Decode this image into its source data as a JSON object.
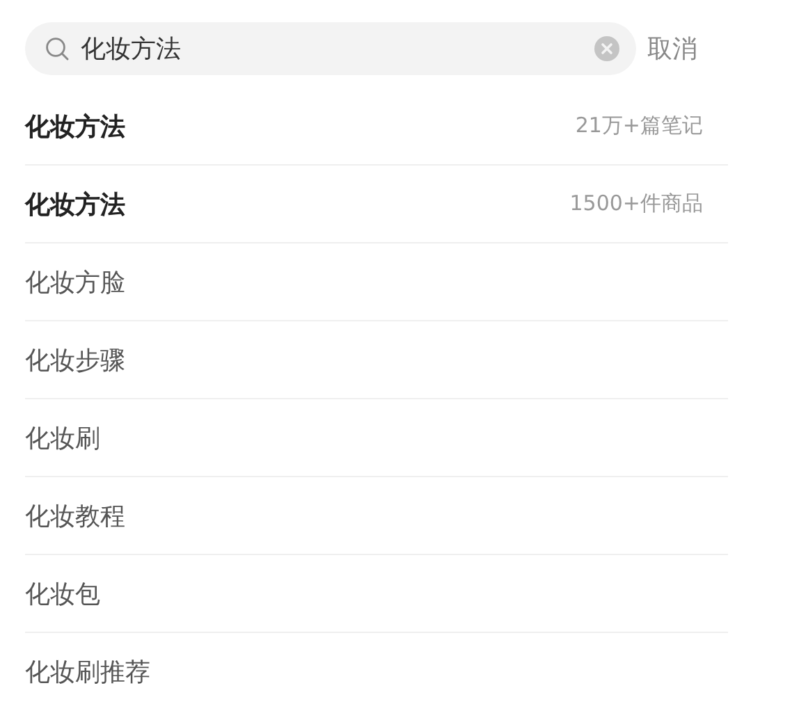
{
  "search": {
    "value": "化妆方法",
    "cancel": "取消"
  },
  "suggestions": [
    {
      "kind": "result",
      "text": "化妆方法",
      "count": "21万+篇笔记"
    },
    {
      "kind": "result",
      "text": "化妆方法",
      "count": "1500+件商品"
    },
    {
      "kind": "plain",
      "text": "化妆方脸"
    },
    {
      "kind": "plain",
      "text": "化妆步骤"
    },
    {
      "kind": "plain",
      "text": "化妆刷"
    },
    {
      "kind": "plain",
      "text": "化妆教程"
    },
    {
      "kind": "plain",
      "text": "化妆包"
    },
    {
      "kind": "plain",
      "text": "化妆刷推荐"
    }
  ]
}
